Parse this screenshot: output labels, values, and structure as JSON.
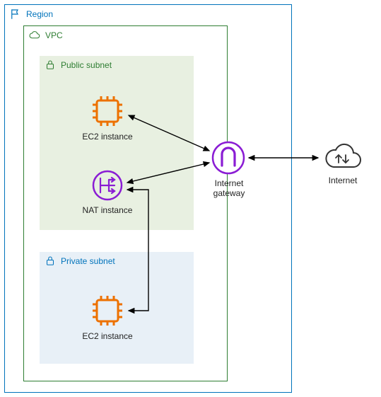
{
  "diagram": {
    "region": {
      "label": "Region"
    },
    "vpc": {
      "label": "VPC"
    },
    "public_subnet": {
      "label": "Public subnet"
    },
    "private_subnet": {
      "label": "Private subnet"
    },
    "ec2_public": {
      "label": "EC2 instance"
    },
    "nat_instance": {
      "label": "NAT instance"
    },
    "ec2_private": {
      "label": "EC2 instance"
    },
    "internet_gateway": {
      "label": "Internet\ngateway",
      "label_line1": "Internet",
      "label_line2": "gateway"
    },
    "internet": {
      "label": "Internet"
    }
  },
  "colors": {
    "region_border": "#0073bb",
    "vpc_border": "#2e7d32",
    "ec2_orange": "#ed7100",
    "purple": "#8a1cd4",
    "arrow": "#000000"
  }
}
